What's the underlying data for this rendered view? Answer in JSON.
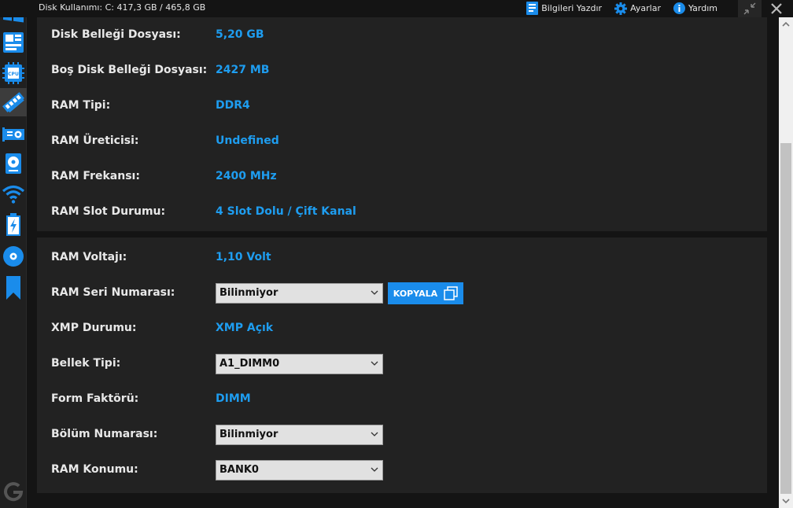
{
  "header": {
    "disk_usage": "Disk Kullanımı: C: 417,3 GB / 465,8 GB",
    "actions": {
      "print": "Bilgileri Yazdır",
      "settings": "Ayarlar",
      "help": "Yardım"
    }
  },
  "sidebar": {
    "items": [
      {
        "icon": "windows-icon"
      },
      {
        "icon": "motherboard-icon"
      },
      {
        "icon": "cpu-icon"
      },
      {
        "icon": "ram-icon"
      },
      {
        "icon": "gpu-icon"
      },
      {
        "icon": "hard-drive-icon"
      },
      {
        "icon": "wifi-icon"
      },
      {
        "icon": "battery-icon"
      },
      {
        "icon": "disc-icon"
      },
      {
        "icon": "bookmark-icon"
      }
    ],
    "active_index": 3
  },
  "panel1": {
    "rows": [
      {
        "label": "Disk Belleği Dosyası:",
        "value": "5,20 GB"
      },
      {
        "label": "Boş Disk Belleği Dosyası:",
        "value": "2427 MB"
      },
      {
        "label": "RAM Tipi:",
        "value": "DDR4"
      },
      {
        "label": "RAM Üreticisi:",
        "value": "Undefined"
      },
      {
        "label": "RAM Frekansı:",
        "value": "2400 MHz"
      },
      {
        "label": "RAM Slot Durumu:",
        "value": "4 Slot Dolu / Çift Kanal"
      }
    ]
  },
  "panel2": {
    "voltage": {
      "label": "RAM Voltajı:",
      "value": "1,10 Volt"
    },
    "serial": {
      "label": "RAM Seri Numarası:",
      "selected": "Bilinmiyor",
      "copy_label": "KOPYALA"
    },
    "xmp": {
      "label": "XMP Durumu:",
      "value": "XMP Açık"
    },
    "memory_type": {
      "label": "Bellek Tipi:",
      "selected": "A1_DIMM0"
    },
    "form_factor": {
      "label": "Form Faktörü:",
      "value": "DIMM"
    },
    "part_number": {
      "label": "Bölüm Numarası:",
      "selected": "Bilinmiyor"
    },
    "location": {
      "label": "RAM Konumu:",
      "selected": "BANK0"
    }
  },
  "colors": {
    "accent": "#1e9df0",
    "button": "#1a8ceb",
    "panel": "#222222",
    "background": "#141414"
  }
}
